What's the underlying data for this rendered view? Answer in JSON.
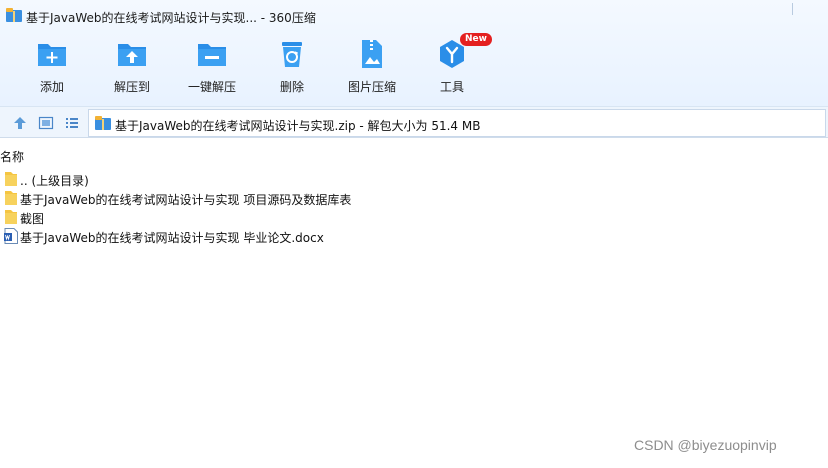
{
  "window": {
    "title": "基于JavaWeb的在线考试网站设计与实现... - 360压缩",
    "app_icon": "archive-icon"
  },
  "toolbar": {
    "items": [
      {
        "label": "添加",
        "icon": "add-file-icon"
      },
      {
        "label": "解压到",
        "icon": "extract-folder-icon"
      },
      {
        "label": "一键解压",
        "icon": "one-click-extract-icon"
      },
      {
        "label": "删除",
        "icon": "recycle-bin-icon"
      },
      {
        "label": "图片压缩",
        "icon": "image-compress-icon"
      },
      {
        "label": "工具",
        "icon": "tools-icon",
        "badge": "New"
      }
    ]
  },
  "addressbar": {
    "path": "基于JavaWeb的在线考试网站设计与实现.zip - 解包大小为 51.4 MB",
    "nav": [
      "up-arrow-icon",
      "detail-view-icon",
      "list-view-icon"
    ]
  },
  "list": {
    "column_name": "名称",
    "rows": [
      {
        "name": ".. (上级目录)",
        "icon": "folder-icon"
      },
      {
        "name": "基于JavaWeb的在线考试网站设计与实现 项目源码及数据库表",
        "icon": "folder-icon"
      },
      {
        "name": "截图",
        "icon": "folder-icon"
      },
      {
        "name": "基于JavaWeb的在线考试网站设计与实现 毕业论文.docx",
        "icon": "word-document-icon"
      }
    ]
  },
  "watermark": "CSDN @biyezuopinvip",
  "colors": {
    "accent_blue": "#2a8ee8",
    "badge_red": "#e42020",
    "folder_yellow": "#f5c542"
  }
}
